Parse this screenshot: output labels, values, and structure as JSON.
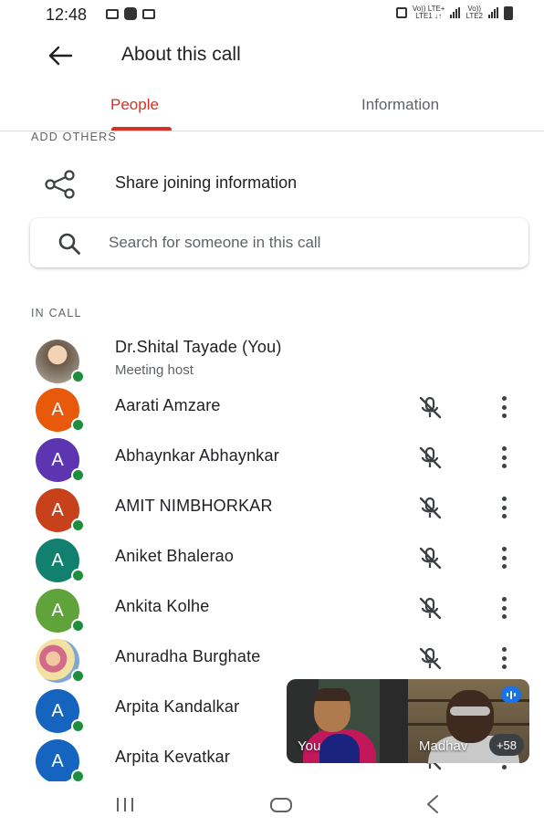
{
  "status_bar": {
    "time": "12:48",
    "carrier_label_1": "Vo)) LTE+",
    "carrier_sub_1": "LTE1 ↓↑",
    "carrier_label_2": "Vo))",
    "carrier_sub_2": "LTE2"
  },
  "header": {
    "title": "About this call",
    "back_icon": "arrow-back-icon"
  },
  "tabs": [
    {
      "label": "People",
      "active": true
    },
    {
      "label": "Information",
      "active": false
    }
  ],
  "add_others": {
    "section_label": "ADD OTHERS",
    "share_label": "Share joining information",
    "share_icon": "share-icon"
  },
  "search": {
    "placeholder": "Search for someone in this call",
    "value": ""
  },
  "in_call": {
    "section_label": "IN CALL",
    "participants": [
      {
        "name": "Dr.Shital Tayade (You)",
        "subtitle": "Meeting host",
        "initial": "",
        "avatar_color": "#8a7f72",
        "photo": true,
        "muted": false
      },
      {
        "name": "Aarati Amzare",
        "initial": "A",
        "avatar_color": "#e8590c",
        "muted": true
      },
      {
        "name": "Abhaynkar Abhaynkar",
        "initial": "A",
        "avatar_color": "#5e35b1",
        "muted": true
      },
      {
        "name": "AMIT NIMBHORKAR",
        "initial": "A",
        "avatar_color": "#c7411a",
        "muted": true
      },
      {
        "name": "Aniket Bhalerao",
        "initial": "A",
        "avatar_color": "#12806f",
        "muted": true
      },
      {
        "name": "Ankita Kolhe",
        "initial": "A",
        "avatar_color": "#5fa33a",
        "muted": true
      },
      {
        "name": "Anuradha Burghate",
        "initial": "",
        "avatar_color": "#d46a8a",
        "photo": true,
        "muted": true
      },
      {
        "name": "Arpita Kandalkar",
        "initial": "A",
        "avatar_color": "#1565c0",
        "muted": true
      },
      {
        "name": "Arpita Kevatkar",
        "initial": "A",
        "avatar_color": "#1565c0",
        "muted": true
      }
    ]
  },
  "video_preview": {
    "self_label": "You",
    "other_label": "Madhav",
    "more_count": "+58"
  },
  "colors": {
    "accent": "#d93025",
    "presence": "#1e8e3e",
    "text_primary": "#202124",
    "text_secondary": "#5f6368"
  }
}
